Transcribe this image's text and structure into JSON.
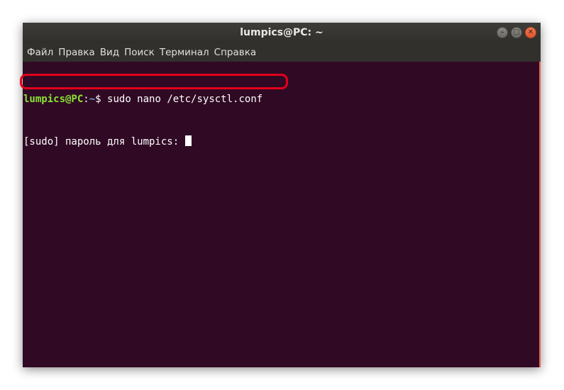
{
  "window": {
    "title": "lumpics@PC: ~",
    "controls": {
      "minimize_icon": "minimize-icon",
      "maximize_icon": "maximize-icon",
      "close_icon": "close-icon"
    }
  },
  "menu": {
    "items": [
      "Файл",
      "Правка",
      "Вид",
      "Поиск",
      "Терминал",
      "Справка"
    ]
  },
  "terminal": {
    "prompt_user": "lumpics@PC",
    "prompt_sep": ":",
    "prompt_path": "~",
    "prompt_symbol": "$",
    "command": " sudo nano /etc/sysctl.conf",
    "password_prompt": "[sudo] пароль для lumpics: "
  },
  "colors": {
    "terminal_bg": "#300a24",
    "prompt_user": "#8ae234",
    "prompt_path": "#729fcf",
    "highlight": "#e2001a",
    "close_button": "#e0532a"
  }
}
